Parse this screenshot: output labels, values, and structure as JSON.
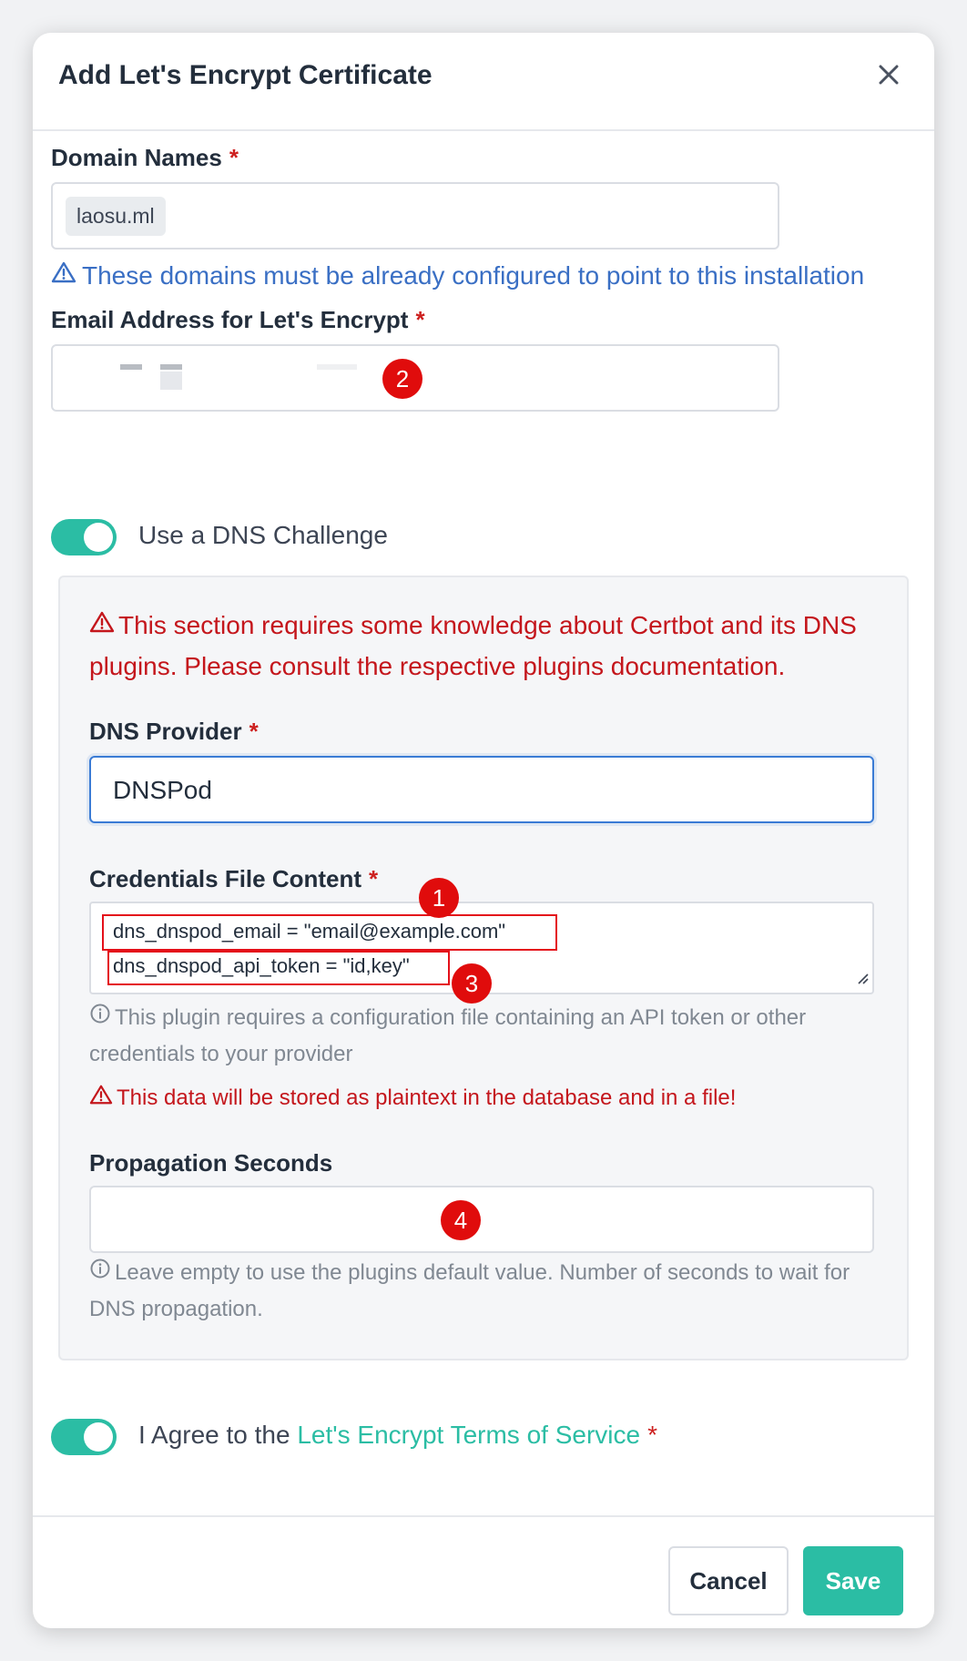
{
  "modal": {
    "title": "Add Let's Encrypt Certificate"
  },
  "domain": {
    "label": "Domain Names",
    "required_mark": "*",
    "chips": [
      "laosu.ml"
    ],
    "hint": "These domains must be already configured to point to this installation"
  },
  "email": {
    "label": "Email Address for Let's Encrypt",
    "required_mark": "*",
    "value": ""
  },
  "dns_challenge": {
    "toggle_label": "Use a DNS Challenge",
    "enabled": true,
    "warning_line1": "This section requires some knowledge about Certbot and its DNS",
    "warning_line2": "plugins. Please consult the respective plugins documentation."
  },
  "dns_provider": {
    "label": "DNS Provider",
    "required_mark": "*",
    "value": "DNSPod"
  },
  "credentials": {
    "label": "Credentials File Content",
    "required_mark": "*",
    "lines": [
      "dns_dnspod_email = \"email@example.com\"",
      "dns_dnspod_api_token = \"id,key\""
    ],
    "help_line1": "This plugin requires a configuration file containing an API token or other",
    "help_line2": "credentials to your provider",
    "warning": "This data will be stored as plaintext in the database and in a file!"
  },
  "propagation": {
    "label": "Propagation Seconds",
    "value": "",
    "help_line1": "Leave empty to use the plugins default value. Number of seconds to wait for",
    "help_line2": "DNS propagation."
  },
  "agree": {
    "prefix": "I Agree to the ",
    "link": "Let's Encrypt Terms of Service",
    "required_mark": "*",
    "enabled": true
  },
  "annotations": [
    "1",
    "2",
    "3",
    "4"
  ],
  "footer": {
    "cancel_label": "Cancel",
    "save_label": "Save"
  },
  "colors": {
    "accent": "#2bbda4",
    "danger": "#cd201f",
    "info": "#3a6fc4",
    "annotation": "#e00c0c"
  }
}
